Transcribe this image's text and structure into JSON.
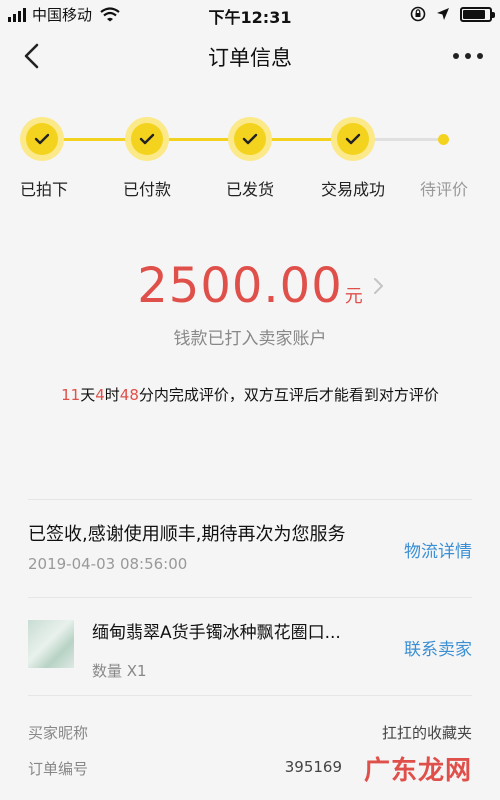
{
  "status_bar": {
    "carrier": "中国移动",
    "time": "下午12:31",
    "battery_level": 0.85
  },
  "nav": {
    "title": "订单信息"
  },
  "progress": {
    "steps": [
      {
        "label": "已拍下",
        "done": true
      },
      {
        "label": "已付款",
        "done": true
      },
      {
        "label": "已发货",
        "done": true
      },
      {
        "label": "交易成功",
        "done": true
      },
      {
        "label": "待评价",
        "done": false
      }
    ],
    "accent_color": "#f4d31f"
  },
  "amount": {
    "value": "2500.00",
    "unit": "元",
    "subtitle": "钱款已打入卖家账户",
    "color": "#e0504a"
  },
  "review_note": {
    "days": "11",
    "days_unit": "天",
    "hours": "4",
    "hours_unit": "时",
    "minutes": "48",
    "text": "分内完成评价，双方互评后才能看到对方评价"
  },
  "logistics": {
    "status": "已签收,感谢使用顺丰,期待再次为您服务",
    "time": "2019-04-03 08:56:00",
    "link": "物流详情",
    "link_color": "#3b8fd4"
  },
  "product": {
    "title": "缅甸翡翠A货手镯冰种飘花圈口...",
    "quantity": "数量 X1",
    "contact": "联系卖家"
  },
  "order_info": {
    "rows": [
      {
        "key": "买家昵称",
        "value": "扛扛的收藏夹"
      },
      {
        "key": "订单编号",
        "value": "395169"
      }
    ]
  },
  "watermark": "广东龙网"
}
